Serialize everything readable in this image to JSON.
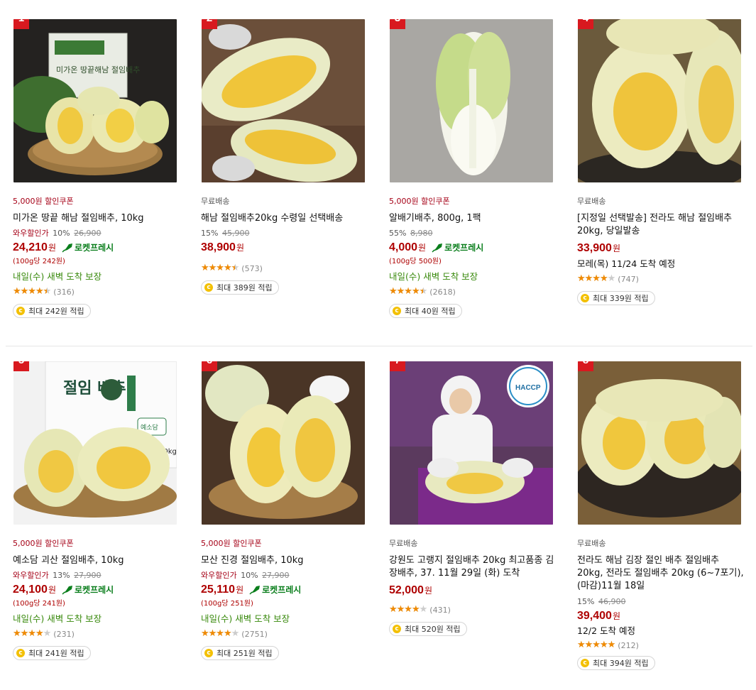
{
  "products": [
    {
      "rank": "1",
      "badge": "5,000원 할인쿠폰",
      "name": "미가온 땅끝 해남 절임배추, 10kg",
      "wow_label": "와우할인가",
      "discount_rate": "10%",
      "original_price": "26,900",
      "price": "24,210",
      "won": "원",
      "rocket": "로켓프레시",
      "unit_price": "(100g당 242원)",
      "arrival": "내일(수) 새벽 도착 보장",
      "rating": 4.5,
      "review_count": "(316)",
      "reward": "최대 242원 적립"
    },
    {
      "rank": "2",
      "badge": "무료배송",
      "name": "해남 절임배추20kg 수령일 선택배송",
      "discount_rate": "15%",
      "original_price": "45,900",
      "price": "38,900",
      "won": "원",
      "rating": 4.5,
      "review_count": "(573)",
      "reward": "최대 389원 적립"
    },
    {
      "rank": "3",
      "badge": "5,000원 할인쿠폰",
      "name": "알배기배추, 800g, 1팩",
      "discount_rate": "55%",
      "original_price": "8,980",
      "price": "4,000",
      "won": "원",
      "rocket": "로켓프레시",
      "unit_price": "(100g당 500원)",
      "arrival": "내일(수) 새벽 도착 보장",
      "rating": 4.5,
      "review_count": "(2618)",
      "reward": "최대 40원 적립"
    },
    {
      "rank": "4",
      "badge": "무료배송",
      "name": "[지정일 선택발송] 전라도 해남 절임배추 20kg, 당일발송",
      "price": "33,900",
      "won": "원",
      "arrival": "모레(목) 11/24 도착 예정",
      "rating": 4.0,
      "review_count": "(747)",
      "reward": "최대 339원 적립"
    },
    {
      "rank": "5",
      "badge": "5,000원 할인쿠폰",
      "name": "예소담 괴산 절임배추, 10kg",
      "wow_label": "와우할인가",
      "discount_rate": "13%",
      "original_price": "27,900",
      "price": "24,100",
      "won": "원",
      "rocket": "로켓프레시",
      "unit_price": "(100g당 241원)",
      "arrival": "내일(수) 새벽 도착 보장",
      "rating": 4.0,
      "review_count": "(231)",
      "reward": "최대 241원 적립"
    },
    {
      "rank": "6",
      "badge": "5,000원 할인쿠폰",
      "name": "모산 진경 절임배추, 10kg",
      "wow_label": "와우할인가",
      "discount_rate": "10%",
      "original_price": "27,900",
      "price": "25,110",
      "won": "원",
      "rocket": "로켓프레시",
      "unit_price": "(100g당 251원)",
      "arrival": "내일(수) 새벽 도착 보장",
      "rating": 4.0,
      "review_count": "(2751)",
      "reward": "최대 251원 적립"
    },
    {
      "rank": "7",
      "badge": "무료배송",
      "name": "강원도 고랭지 절임배추 20kg 최고품종 김장배추, 37. 11월 29일 (화) 도착",
      "price": "52,000",
      "won": "원",
      "rating": 4.0,
      "review_count": "(431)",
      "reward": "최대 520원 적립",
      "haccp": "HACCP"
    },
    {
      "rank": "8",
      "badge": "무료배송",
      "name": "전라도 해남 김장 절인 배추 절임배추 20kg, 전라도 절임배추 20kg (6~7포기), (마감)11월 18일",
      "discount_rate": "15%",
      "original_price": "46,900",
      "price": "39,400",
      "won": "원",
      "arrival": "12/2 도착 예정",
      "rating": 5.0,
      "review_count": "(212)",
      "reward": "최대 394원 적립"
    }
  ],
  "thumb_text": {
    "p1_box": "미가온 땅끝해남 절임배추",
    "p5_box": "절임 배추",
    "p5_brand": "예소담",
    "p5_weight": "10kg"
  },
  "colors": {
    "rank_bg": "#d8191f",
    "price": "#ae0000",
    "rocket": "#0a7e1c",
    "arrival": "#3a8a0e",
    "star": "#f08a00"
  },
  "icons": {
    "rank": "rank-flag-icon",
    "rocket": "rocket-icon",
    "star": "star-icon",
    "coin": "coin-icon"
  }
}
